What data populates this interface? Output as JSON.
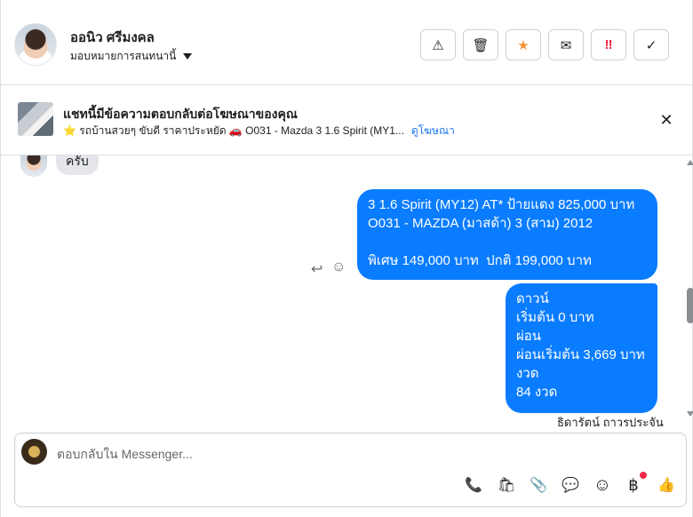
{
  "header": {
    "contact_name": "ออนิว ศรีมงคล",
    "assign_label": "มอบหมายการสนทนานี้",
    "toolbar": [
      {
        "name": "spam-button",
        "icon": "warning-icon",
        "glyph": "⚠"
      },
      {
        "name": "delete-button",
        "icon": "trash-icon",
        "glyph": "🗑"
      },
      {
        "name": "star-button",
        "icon": "star-icon",
        "glyph": "★"
      },
      {
        "name": "mark-unread-button",
        "icon": "envelope-icon",
        "glyph": "✉"
      },
      {
        "name": "follow-up-button",
        "icon": "exclamation-icon",
        "glyph": "‼"
      },
      {
        "name": "mark-done-button",
        "icon": "check-icon",
        "glyph": "✓"
      }
    ]
  },
  "ad": {
    "title": "แชทนี้มีข้อความตอบกลับต่อโฆษณาของคุณ",
    "subtitle": "⭐ รถบ้านสวยๆ ขับดี ราคาประหยัด 🚗 O031 - Mazda 3 1.6 Spirit (MY1...",
    "link": "ดูโฆษณา"
  },
  "messages": {
    "incoming": "ครับ",
    "outgoing_1": "3 1.6 Spirit (MY12) AT* ป้ายแดง 825,000 บาท\nO031 - MAZDA (มาสด้า) 3 (สาม) 2012\n\nพิเศษ 149,000 บาท  ปกติ 199,000 บาท",
    "outgoing_2": "ดาวน์\nเริ่มต้น 0 บาท\nผ่อน\nผ่อนเริ่มต้น 3,669 บาท\nงวด\n84 งวด",
    "sender_name": "ธิดารัตน์ ถาวรประจัน"
  },
  "composer": {
    "placeholder": "ตอบกลับใน Messenger...",
    "tools": [
      {
        "name": "call-add-icon",
        "glyph": "📞"
      },
      {
        "name": "shopping-bag-icon",
        "glyph": "🛍"
      },
      {
        "name": "paperclip-icon",
        "glyph": "📎"
      },
      {
        "name": "saved-reply-icon",
        "glyph": "💬"
      },
      {
        "name": "emoji-icon",
        "glyph": "☺"
      },
      {
        "name": "baht-icon",
        "glyph": "฿"
      },
      {
        "name": "thumbs-up-icon",
        "glyph": "👍"
      }
    ]
  },
  "colors": {
    "bubble_blue": "#0a7cff",
    "link_blue": "#1877f2",
    "star_orange": "#f7923b",
    "alert_red": "#f02849"
  }
}
